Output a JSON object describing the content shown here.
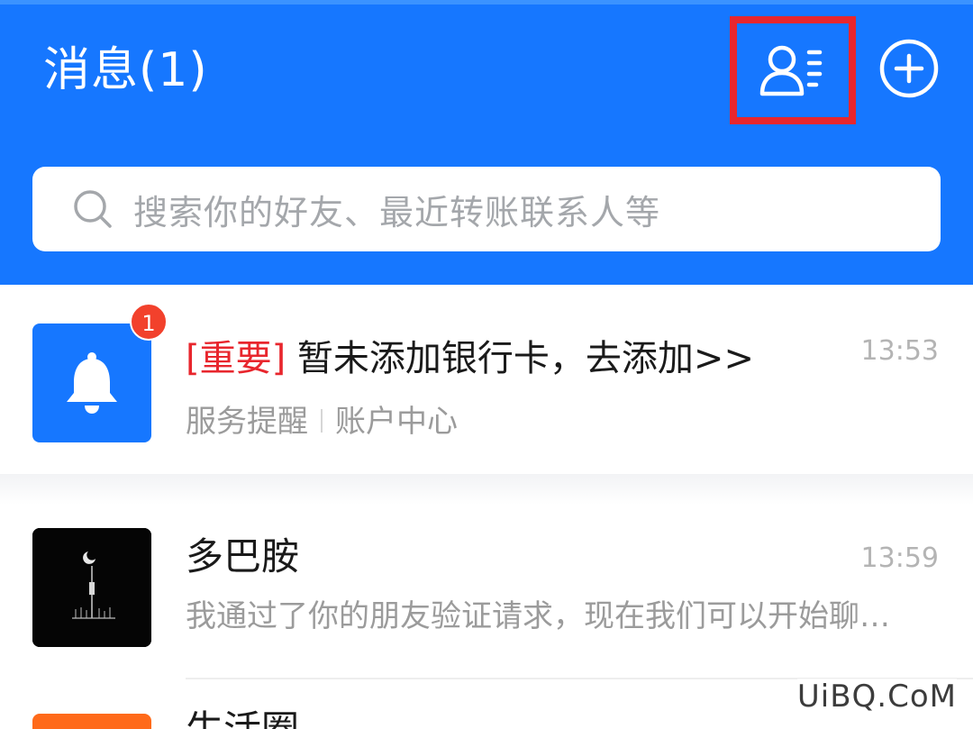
{
  "header": {
    "title": "消息(1)",
    "contacts_icon": "contacts-list-icon",
    "add_icon": "plus-circle-icon",
    "highlight_color": "#e8262d",
    "bg_color": "#1677ff"
  },
  "search": {
    "icon": "search-icon",
    "placeholder": "搜索你的好友、最近转账联系人等"
  },
  "messages": [
    {
      "avatar_icon": "bell-icon",
      "badge": "1",
      "tag": "[重要]",
      "title": " 暂未添加银行卡，去添加>>",
      "source": "服务提醒",
      "category": "账户中心",
      "time": "13:53"
    },
    {
      "avatar_icon": "night-scene-avatar",
      "title": "多巴胺",
      "preview": "我通过了你的朋友验证请求，现在我们可以开始聊天了",
      "time": "13:59"
    },
    {
      "title": "生活圈"
    }
  ],
  "watermark": "UiBQ.CoM"
}
